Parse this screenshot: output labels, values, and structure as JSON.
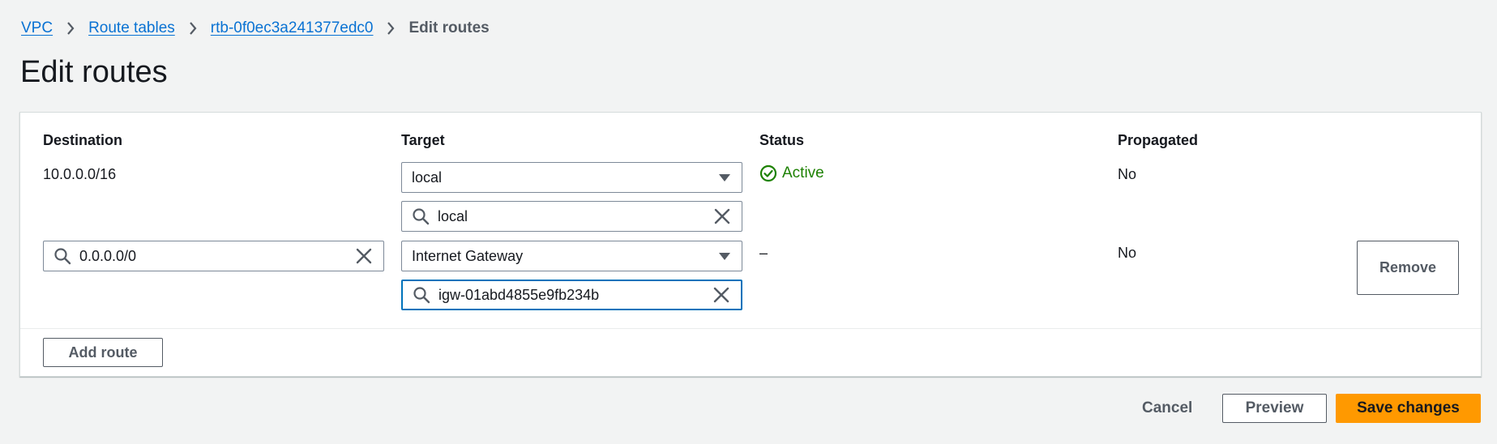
{
  "breadcrumb": {
    "items": [
      {
        "label": "VPC"
      },
      {
        "label": "Route tables"
      },
      {
        "label": "rtb-0f0ec3a241377edc0"
      }
    ],
    "current": "Edit routes"
  },
  "page": {
    "title": "Edit routes"
  },
  "table": {
    "headers": {
      "destination": "Destination",
      "target": "Target",
      "status": "Status",
      "propagated": "Propagated"
    },
    "routes": [
      {
        "destination": "10.0.0.0/16",
        "target_type": "local",
        "target_search": "local",
        "status": "Active",
        "propagated": "No"
      },
      {
        "destination": "0.0.0.0/0",
        "target_type": "Internet Gateway",
        "target_search": "igw-01abd4855e9fb234b",
        "status": "–",
        "propagated": "No",
        "remove_label": "Remove"
      }
    ]
  },
  "actions": {
    "add_route": "Add route",
    "cancel": "Cancel",
    "preview": "Preview",
    "save": "Save changes"
  },
  "colors": {
    "link": "#0972d3",
    "active_status": "#1d8102",
    "primary_button": "#ff9900",
    "focus_border": "#0073bb"
  }
}
